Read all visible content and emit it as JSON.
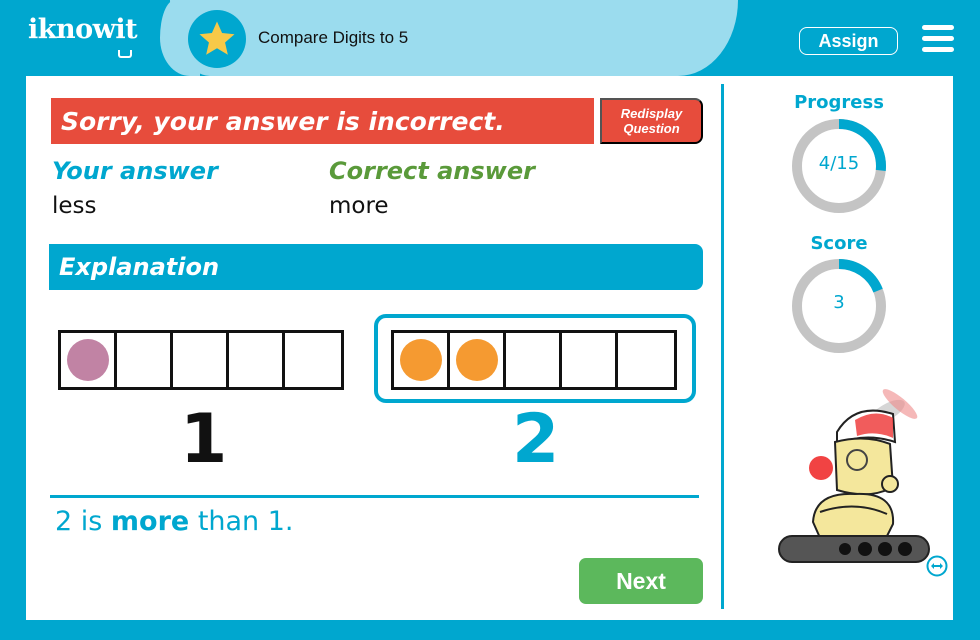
{
  "header": {
    "logo_text": "iknowit",
    "lesson_title": "Compare Digits to 5",
    "assign_label": "Assign",
    "icons": {
      "lesson": "star-icon",
      "menu": "hamburger-menu-icon"
    }
  },
  "feedback": {
    "message": "Sorry, your answer is incorrect.",
    "redisplay_line1": "Redisplay",
    "redisplay_line2": "Question",
    "your_answer_label": "Your answer",
    "your_answer_value": "less",
    "correct_answer_label": "Correct answer",
    "correct_answer_value": "more"
  },
  "explanation": {
    "title": "Explanation",
    "frames": [
      {
        "number": "1",
        "filled": 1,
        "cells": 5,
        "dot_color": "#c183a4",
        "number_color": "#111111",
        "highlighted": false
      },
      {
        "number": "2",
        "filled": 2,
        "cells": 5,
        "dot_color": "#f59a31",
        "number_color": "#00a7cf",
        "highlighted": true
      }
    ],
    "summary_pre": "2 is ",
    "summary_bold": "more",
    "summary_post": " than 1."
  },
  "next_label": "Next",
  "sidebar": {
    "progress_label": "Progress",
    "progress_text": "4/15",
    "progress_fraction": 0.2667,
    "score_label": "Score",
    "score_text": "3",
    "score_fraction": 0.19,
    "mascot": "robot-mascot",
    "swap_icon": "swap-arrows-icon"
  },
  "colors": {
    "brand": "#00a7cf",
    "brand_light": "#9bdcee",
    "error": "#e74c3c",
    "success": "#5cb85c",
    "correct_label": "#5a9a3a",
    "ring_track": "#c4c4c4"
  }
}
